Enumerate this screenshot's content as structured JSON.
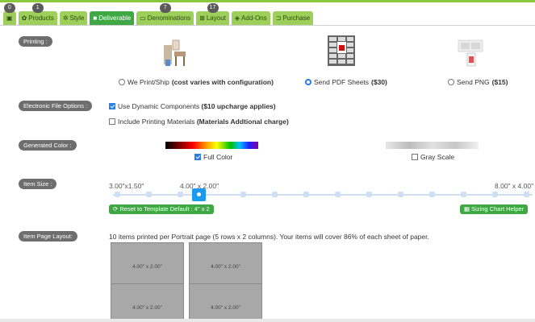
{
  "tabs": [
    {
      "label": "",
      "icon": "image-icon",
      "badge": "0"
    },
    {
      "label": "Products",
      "icon": "gear-icon",
      "badge": "1"
    },
    {
      "label": "Style",
      "icon": "gears-icon",
      "badge": ""
    },
    {
      "label": "Deliverable",
      "icon": "car-icon",
      "badge": ""
    },
    {
      "label": "Denominations",
      "icon": "money-icon",
      "badge": "7"
    },
    {
      "label": "Layout",
      "icon": "layout-icon",
      "badge": "17"
    },
    {
      "label": "Add-Ons",
      "icon": "diamond-icon",
      "badge": ""
    },
    {
      "label": "Purchase",
      "icon": "cart-icon",
      "badge": ""
    }
  ],
  "printing": {
    "label": "Printing :",
    "we_print_text": "We Print/Ship",
    "we_print_note": "(cost varies with configuration)",
    "pdf_text": "Send PDF Sheets",
    "pdf_price": "($30)",
    "png_text": "Send PNG",
    "png_price": "($15)",
    "selected": "pdf"
  },
  "electronic": {
    "label": "Electronic File Options :",
    "dynamic_text": "Use Dynamic Components",
    "dynamic_note": "($10 upcharge applies)",
    "dynamic_checked": true,
    "printing_text": "Include Printing Materials",
    "printing_note": "(Materials Addtional charge)",
    "printing_checked": false
  },
  "color": {
    "label": "Generated Color :",
    "full_label": "Full Color",
    "full_checked": true,
    "gray_label": "Gray Scale",
    "gray_checked": false
  },
  "size": {
    "label": "Item Size :",
    "min_label": "3.00\"x1.50\"",
    "current_label": "4.00\" x 2.00\"",
    "max_label": "8.00\" x 4.00\"",
    "reset_label": "Reset to Template Default : 4\" x 2",
    "sizing_label": "Sizing Chart Helper"
  },
  "layout": {
    "label": "Item Page Layout:",
    "summary": "10 items printed per Portrait page (5 rows x 2 columns). Your items will cover 86% of each sheet of paper.",
    "cells": [
      "4.00\" x 2.00\"",
      "4.00\" x 2.00\"",
      "4.00\" x 2.00\"",
      "4.00\" x 2.00\""
    ]
  }
}
